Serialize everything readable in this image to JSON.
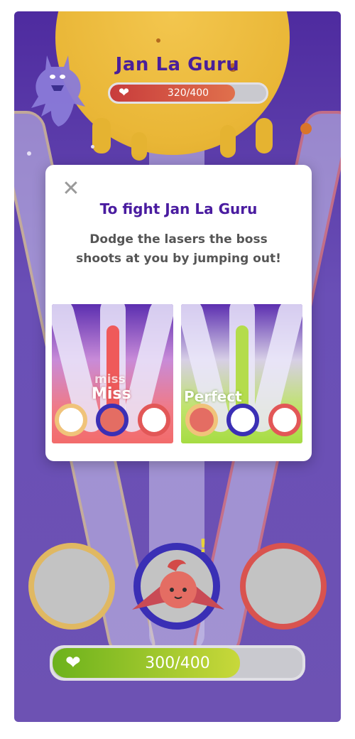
{
  "boss": {
    "name": "Jan La Guru",
    "hp_text": "320/400",
    "hp_fraction": 0.8
  },
  "player": {
    "hp_text": "300/400",
    "hp_fraction": 0.75
  },
  "modal": {
    "close_icon": "close-icon",
    "title": "To fight Jan La Guru",
    "description": "Dodge the lasers the boss shoots at you by jumping out!",
    "examples": [
      {
        "judgement_top": "miss",
        "judgement": "Miss"
      },
      {
        "judgement": "Perfect"
      }
    ]
  },
  "colors": {
    "background": "#6a4fb6",
    "sun": "#e9b636",
    "boss_title": "#4a1f9a",
    "modal_title": "#4a1ca0",
    "boss_hp_fill": "#d95b48",
    "player_hp_fill": "#7fba1c",
    "lane_yellow": "#e0b862",
    "lane_blue": "#3a2fb5",
    "lane_red": "#d9534f"
  },
  "icons": {
    "heart": "heart-icon",
    "boss": "boss-ghost-icon",
    "player": "player-character-icon",
    "alert": "exclamation-icon"
  }
}
